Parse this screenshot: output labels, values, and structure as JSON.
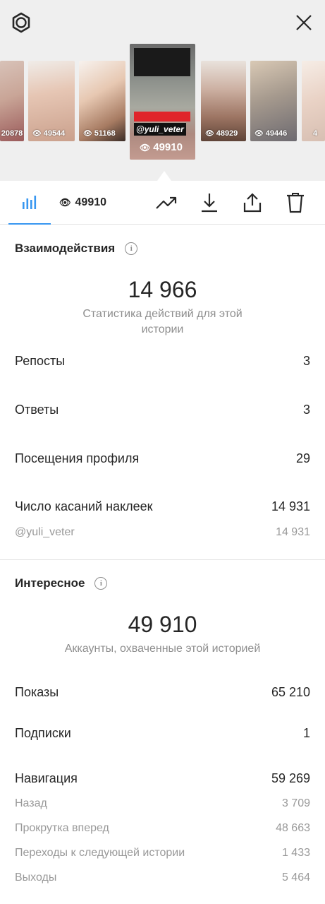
{
  "header": {
    "settings_icon": "gear-icon",
    "close_icon": "close-icon"
  },
  "stories": [
    {
      "views": "20878"
    },
    {
      "views": "49544"
    },
    {
      "views": "51168"
    },
    {
      "views": "49910",
      "current": true,
      "tag": "@yuli_veter"
    },
    {
      "views": "48929"
    },
    {
      "views": "49446"
    },
    {
      "views": "4"
    }
  ],
  "toolbar": {
    "view_count": "49910",
    "icons": [
      "bar-chart-icon",
      "eye-icon",
      "trending-up-icon",
      "download-icon",
      "share-icon",
      "trash-icon"
    ],
    "accent": "#3897f0"
  },
  "interactions": {
    "title": "Взаимодействия",
    "total": "14 966",
    "caption": "Статистика действий для этой истории",
    "rows": [
      {
        "label": "Репосты",
        "value": "3"
      },
      {
        "label": "Ответы",
        "value": "3"
      },
      {
        "label": "Посещения профиля",
        "value": "29"
      },
      {
        "label": "Число касаний наклеек",
        "value": "14 931"
      }
    ],
    "sub": {
      "label": "@yuli_veter",
      "value": "14 931"
    }
  },
  "discovery": {
    "title": "Интересное",
    "total": "49 910",
    "caption": "Аккаунты, охваченные этой историей",
    "rows": [
      {
        "label": "Показы",
        "value": "65 210"
      },
      {
        "label": "Подписки",
        "value": "1"
      },
      {
        "label": "Навигация",
        "value": "59 269"
      }
    ],
    "nav_rows": [
      {
        "label": "Назад",
        "value": "3 709"
      },
      {
        "label": "Прокрутка вперед",
        "value": "48 663"
      },
      {
        "label": "Переходы к следующей истории",
        "value": "1 433"
      },
      {
        "label": "Выходы",
        "value": "5 464"
      }
    ]
  }
}
